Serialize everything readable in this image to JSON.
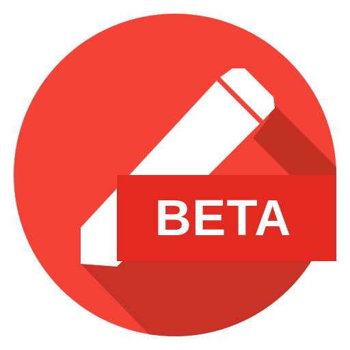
{
  "app_icon": {
    "badge_label": "BETA",
    "glyph": "pencil-icon",
    "colors": {
      "circle": "#f44336",
      "long_shadow": "#bf2f24",
      "banner": "#e32a20",
      "pencil": "#ffffff",
      "label": "#ffffff"
    }
  }
}
